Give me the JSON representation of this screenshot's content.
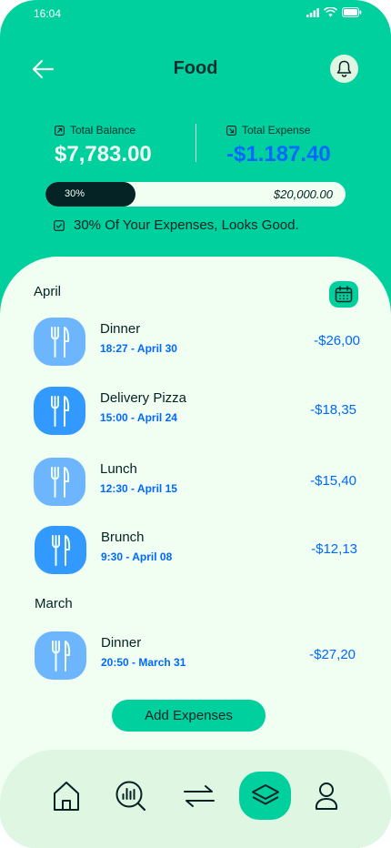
{
  "status": {
    "time": "16:04"
  },
  "header": {
    "title": "Food"
  },
  "summary": {
    "balance_label": "Total Balance",
    "balance_value": "$7,783.00",
    "expense_label": "Total Expense",
    "expense_value": "-$1.187.40"
  },
  "progress": {
    "percent_label": "30%",
    "fraction": 0.3,
    "total": "$20,000.00"
  },
  "note": "30% Of Your Expenses, Looks Good.",
  "months": [
    {
      "name": "April",
      "transactions": [
        {
          "title": "Dinner",
          "time": "18:27 - April 30",
          "amount": "-$26,00",
          "shade": "light"
        },
        {
          "title": "Delivery Pizza",
          "time": "15:00 - April 24",
          "amount": "-$18,35",
          "shade": "dark"
        },
        {
          "title": "Lunch",
          "time": "12:30 - April 15",
          "amount": "-$15,40",
          "shade": "light"
        },
        {
          "title": "Brunch",
          "time": "9:30 - April 08",
          "amount": "-$12,13",
          "shade": "dark"
        }
      ]
    },
    {
      "name": "March",
      "transactions": [
        {
          "title": "Dinner",
          "time": "20:50 - March 31",
          "amount": "-$27,20",
          "shade": "light"
        }
      ]
    }
  ],
  "add_button": "Add Expenses",
  "colors": {
    "primary": "#00D09E",
    "light_blue": "#6DB6FE",
    "dark_blue": "#3299FF",
    "accent_blue": "#0068FF"
  },
  "nav": [
    "home-icon",
    "analysis-icon",
    "transfer-icon",
    "layers-icon",
    "profile-icon"
  ],
  "nav_active": "layers-icon"
}
